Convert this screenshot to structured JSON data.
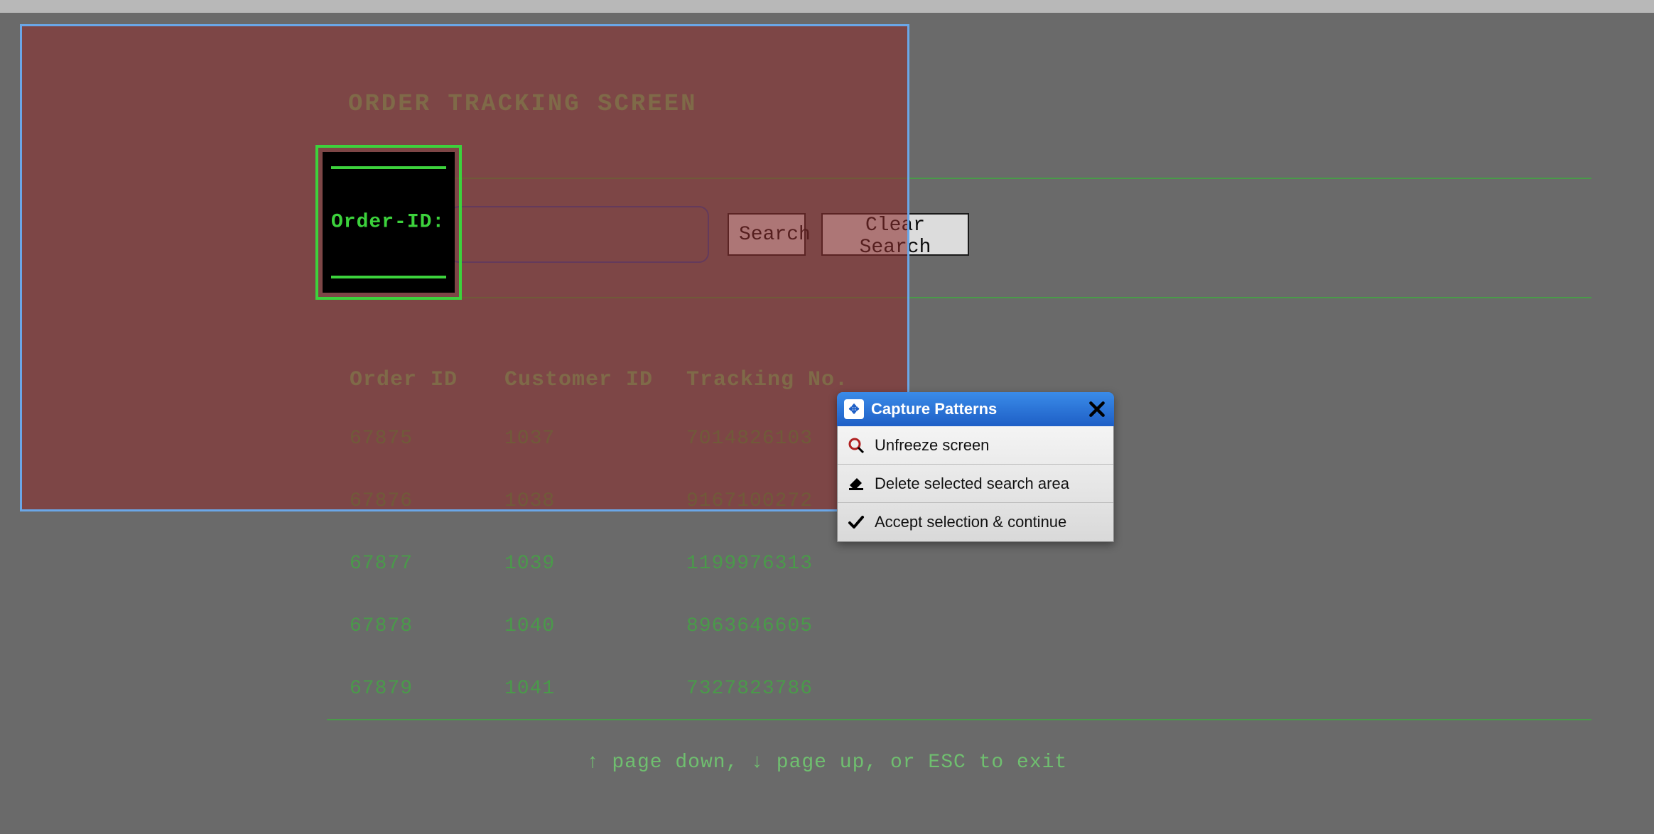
{
  "title": "ORDER TRACKING SCREEN",
  "field_label": "Order-ID:",
  "search_input_value": "",
  "buttons": {
    "search": "Search",
    "clear": "Clear Search"
  },
  "columns": {
    "order": "Order ID",
    "customer": "Customer ID",
    "tracking": "Tracking No."
  },
  "rows": [
    {
      "order": "67875",
      "customer": "1037",
      "tracking": "7014826103"
    },
    {
      "order": "67876",
      "customer": "1038",
      "tracking": "9167100272"
    },
    {
      "order": "67877",
      "customer": "1039",
      "tracking": "1199976313"
    },
    {
      "order": "67878",
      "customer": "1040",
      "tracking": "8963646605"
    },
    {
      "order": "67879",
      "customer": "1041",
      "tracking": "7327823786"
    }
  ],
  "footer": "↑ page down, ↓ page up, or ESC to exit",
  "menu": {
    "title": "Capture Patterns",
    "items": [
      {
        "icon": "magnifier-icon",
        "label": "Unfreeze screen"
      },
      {
        "icon": "eraser-icon",
        "label": "Delete selected search area"
      },
      {
        "icon": "check-icon",
        "label": "Accept selection & continue"
      }
    ]
  }
}
